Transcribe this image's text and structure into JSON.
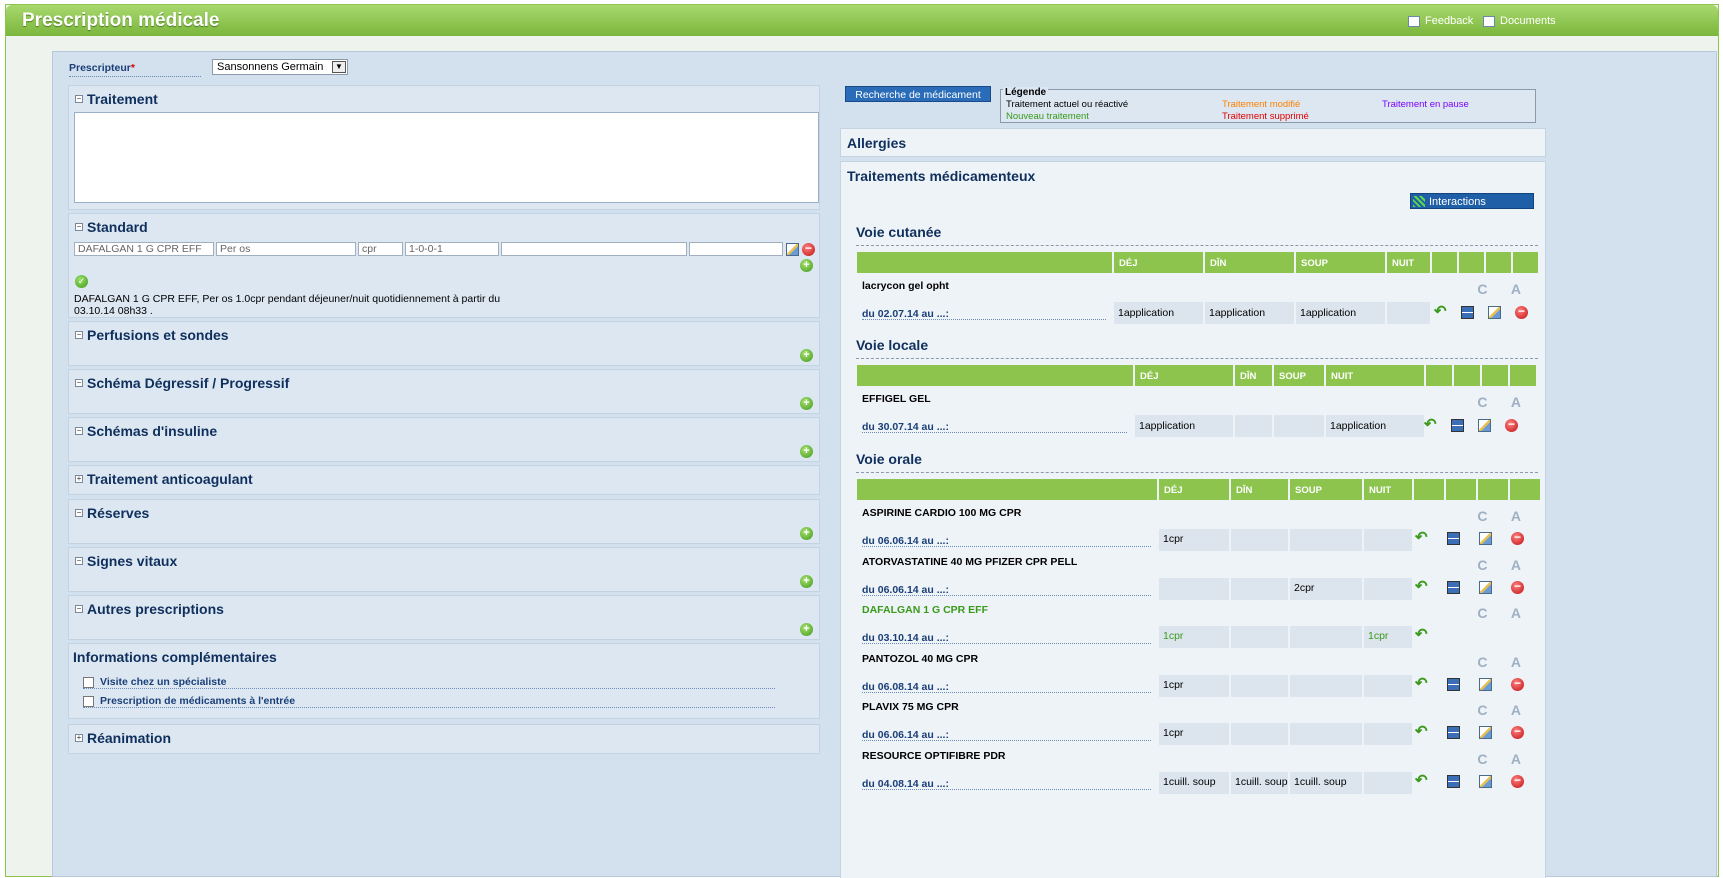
{
  "window": {
    "title": "Prescription médicale",
    "feedback": "Feedback",
    "documents": "Documents"
  },
  "prescripteur": {
    "label": "Prescripteur",
    "required": "*",
    "value": "Sansonnens Germain"
  },
  "sections": {
    "traitement": "Traitement",
    "standard": "Standard",
    "perfusions": "Perfusions et sondes",
    "schema": "Schéma Dégressif / Progressif",
    "insuline": "Schémas d'insuline",
    "anticoag": "Traitement anticoagulant",
    "reserves": "Réserves",
    "signes": "Signes vitaux",
    "autres": "Autres prescriptions",
    "infos": "Informations complémentaires",
    "reanimation": "Réanimation"
  },
  "standard": {
    "fields": [
      "DAFALGAN 1 G CPR EFF",
      "Per os",
      "cpr",
      "1-0-0-1",
      "",
      ""
    ],
    "summary": "DAFALGAN 1 G CPR EFF, Per os 1.0cpr pendant déjeuner/nuit quotidiennement à partir du 03.10.14 08h33 ."
  },
  "infos": {
    "visite": "Visite chez un spécialiste",
    "entree": "Prescription de médicaments à l'entrée"
  },
  "search_button": "Recherche de médicament",
  "legend": {
    "title": "Légende",
    "actuel": "Traitement actuel ou réactivé",
    "nouveau": "Nouveau traitement",
    "modifie": "Traitement modifié",
    "supprime": "Traitement supprimé",
    "pause": "Traitement en pause",
    "colors": {
      "actuel": "#000000",
      "nouveau": "#3a9a1a",
      "modifie": "#ff8000",
      "supprime": "#e00000",
      "pause": "#7a00ff"
    }
  },
  "allergies": "Allergies",
  "traitements_title": "Traitements médicamenteux",
  "interactions": "Interactions",
  "ca": "C A",
  "voies": {
    "cutanee": {
      "title": "Voie cutanée",
      "headers": [
        "DÉJ",
        "DÎN",
        "SOUP",
        "NUIT"
      ],
      "items": [
        {
          "name": "lacrycon gel opht",
          "date": "du 02.07.14 au ...:",
          "dej": "1application",
          "din": "1application",
          "soup": "1application",
          "nuit": ""
        }
      ]
    },
    "locale": {
      "title": "Voie locale",
      "headers": [
        "DÉJ",
        "DÎN",
        "SOUP",
        "NUIT"
      ],
      "items": [
        {
          "name": "EFFIGEL GEL",
          "date": "du 30.07.14 au ...:",
          "dej": "1application",
          "din": "",
          "soup": "",
          "nuit": "1application"
        }
      ]
    },
    "orale": {
      "title": "Voie orale",
      "headers": [
        "DÉJ",
        "DÎN",
        "SOUP",
        "NUIT"
      ],
      "items": [
        {
          "name": "ASPIRINE CARDIO 100 MG CPR",
          "date": "du 06.06.14 au ...:",
          "dej": "1cpr",
          "din": "",
          "soup": "",
          "nuit": ""
        },
        {
          "name": "ATORVASTATINE 40 MG PFIZER CPR PELL",
          "date": "du 06.06.14 au ...:",
          "dej": "",
          "din": "",
          "soup": "2cpr",
          "nuit": ""
        },
        {
          "name": "DAFALGAN 1 G CPR EFF",
          "date": "du 03.10.14 au ...:",
          "dej": "1cpr",
          "din": "",
          "soup": "",
          "nuit": "1cpr"
        },
        {
          "name": "PANTOZOL 40 MG CPR",
          "date": "du 06.08.14 au ...:",
          "dej": "1cpr",
          "din": "",
          "soup": "",
          "nuit": ""
        },
        {
          "name": "PLAVIX 75 MG CPR",
          "date": "du 06.06.14 au ...:",
          "dej": "1cpr",
          "din": "",
          "soup": "",
          "nuit": ""
        },
        {
          "name": "RESOURCE OPTIFIBRE PDR",
          "date": "du 04.08.14 au ...:",
          "dej": "1cuill. soup",
          "din": "1cuill. soup",
          "soup": "1cuill. soup",
          "nuit": ""
        }
      ]
    }
  }
}
